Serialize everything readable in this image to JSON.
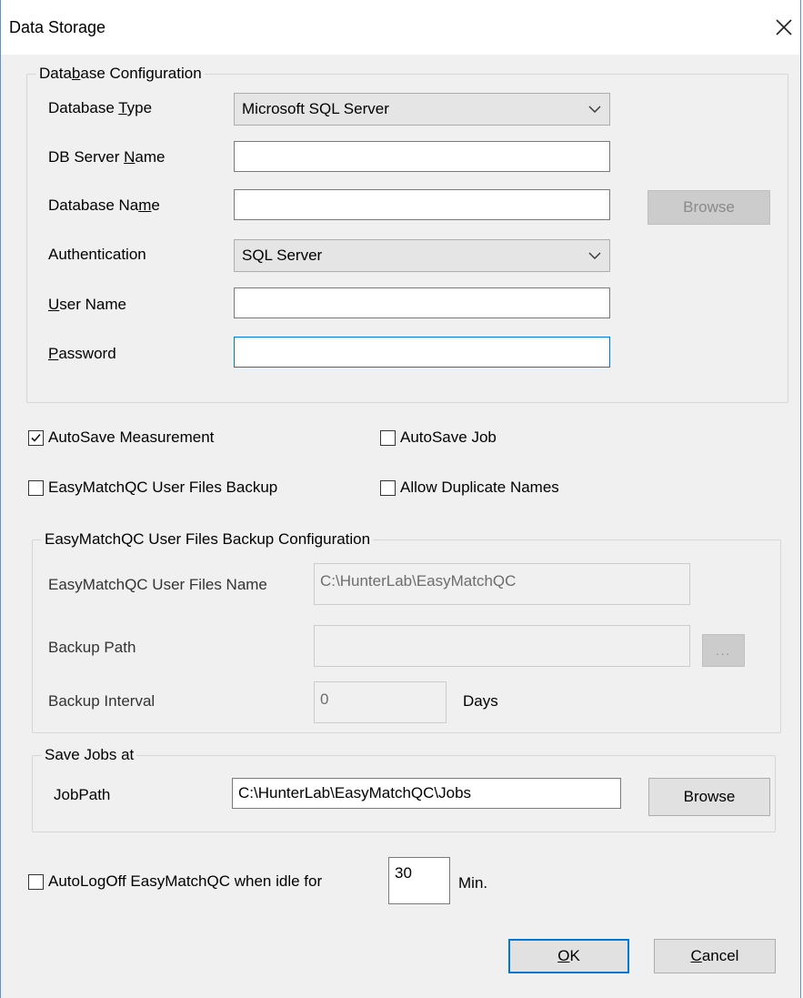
{
  "window": {
    "title": "Data Storage",
    "close_glyph": "✕"
  },
  "db_config": {
    "group_title": "Database Configuration",
    "database_type_label": "Database Type",
    "database_type_value": "Microsoft SQL Server",
    "db_server_name_label": "DB Server Name",
    "db_server_name_value": "",
    "database_name_label": "Database Name",
    "database_name_value": "",
    "browse_label": "Browse",
    "authentication_label": "Authentication",
    "authentication_value": "SQL Server",
    "user_name_label": "User Name",
    "user_name_value": "",
    "password_label": "Password",
    "password_value": ""
  },
  "options": {
    "autosave_measurement": {
      "label": "AutoSave Measurement",
      "checked": true
    },
    "autosave_job": {
      "label": "AutoSave Job",
      "checked": false
    },
    "user_files_backup": {
      "label": "EasyMatchQC User Files Backup",
      "checked": false
    },
    "allow_duplicate_names": {
      "label": "Allow Duplicate Names",
      "checked": false
    }
  },
  "backup_config": {
    "group_title": "EasyMatchQC User Files Backup Configuration",
    "user_files_name_label": "EasyMatchQC User Files Name",
    "user_files_name_value": "C:\\HunterLab\\EasyMatchQC",
    "backup_path_label": "Backup Path",
    "backup_path_value": "",
    "backup_path_browse_label": "...",
    "backup_interval_label": "Backup Interval",
    "backup_interval_value": "0",
    "days_label": "Days"
  },
  "save_jobs": {
    "group_title": "Save Jobs at",
    "job_path_label": "JobPath",
    "job_path_value": "C:\\HunterLab\\EasyMatchQC\\Jobs",
    "browse_label": "Browse"
  },
  "autologoff": {
    "label": "AutoLogOff EasyMatchQC when idle for",
    "checked": false,
    "minutes_value": "30",
    "min_label": "Min."
  },
  "footer": {
    "ok_label": "OK",
    "cancel_label": "Cancel"
  },
  "colors": {
    "accent": "#0078d7",
    "dialog_bg": "#f0f0f0"
  }
}
